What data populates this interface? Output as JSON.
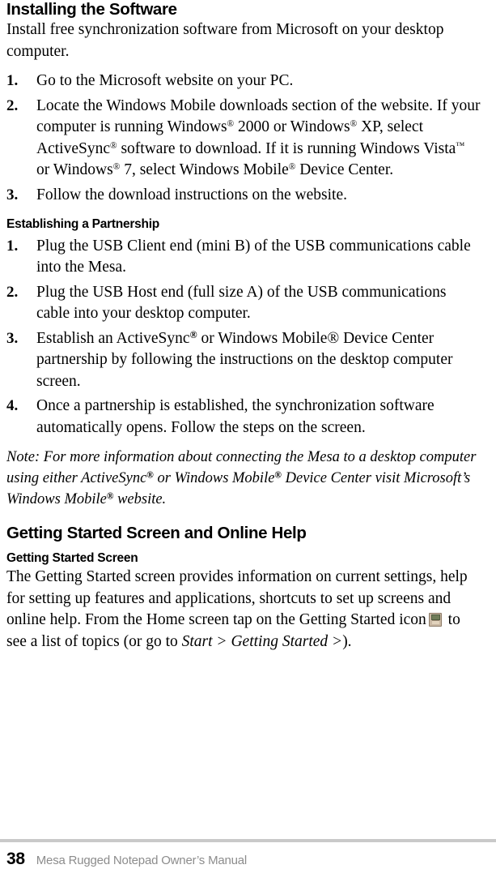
{
  "page": {
    "number": "38",
    "footer_label": "Mesa Rugged Notepad Owner’s Manual"
  },
  "install_section": {
    "heading": "Installing the Software",
    "intro": "Install free synchronization software from Microsoft on your desktop computer.",
    "steps": [
      {
        "number": "1.",
        "text": "Go to the Microsoft website on your PC."
      },
      {
        "number": "2.",
        "text_part_1": "Locate the Windows Mobile downloads section of the website. If your computer is running Windows",
        "mark_1": "®",
        "text_part_2": " 2000 or Windows",
        "mark_2": "®",
        "text_part_3": " XP, select ActiveSync",
        "mark_3": "®",
        "text_part_4": " software to download. If it is running  Windows Vista",
        "mark_4": "™",
        "text_part_5": " or Windows",
        "mark_5": "®",
        "text_part_6": " 7, select Windows Mobile",
        "mark_6": "®",
        "text_part_7": " Device Center."
      },
      {
        "number": "3.",
        "text": "Follow the download instructions on the website."
      }
    ]
  },
  "partnership_section": {
    "heading": "Establishing a Partnership",
    "steps": [
      {
        "number": "1.",
        "text": "Plug the USB Client end (mini B) of the USB communications cable into the Mesa."
      },
      {
        "number": "2.",
        "text": "Plug the USB Host end (full size A) of the USB communications cable into your desktop computer."
      },
      {
        "number": "3.",
        "text_part_1": "Establish an ActiveSync",
        "mark_1": "®",
        "text_part_2": " or Windows Mobile® Device Center partnership by following the instructions on the desktop computer screen."
      },
      {
        "number": "4.",
        "text": "Once a partnership is established, the synchronization software automatically opens. Follow the steps on the screen."
      }
    ],
    "note_part_1": "Note: For more information about connecting the Mesa to a desktop computer using either ActiveSync",
    "note_mark_1": "®",
    "note_part_2": " or Windows Mobile",
    "note_mark_2": "®",
    "note_part_3": " Device Center visit Microsoft’s Windows Mobile",
    "note_mark_3": "®",
    "note_part_4": " website."
  },
  "getting_started_section": {
    "heading": "Getting Started Screen and Online Help",
    "sub_heading": "Getting Started Screen",
    "paragraph_part_1": "The Getting Started screen provides information on current settings, help for setting up features and applications, shortcuts to set up screens and online help. From the Home screen tap on the Getting Started icon",
    "icon_name": "getting-started-icon",
    "paragraph_part_2": " to see a list of topics (or go to ",
    "paragraph_italic": "Start > Getting Started >",
    "paragraph_part_3": ")."
  }
}
